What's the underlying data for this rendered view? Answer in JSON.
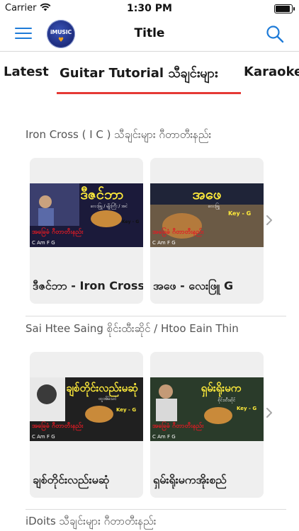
{
  "status_bar": {
    "carrier": "Carrier",
    "time": "1:30 PM",
    "battery_level": 1.0
  },
  "navbar": {
    "title": "Title",
    "logo_text": "iMUSIC"
  },
  "tabs": [
    {
      "label": "Latest"
    },
    {
      "label": "Guitar Tutorial သီချင်းများ"
    },
    {
      "label": "Karaoke"
    }
  ],
  "sections": [
    {
      "title": "Iron Cross ( I C ) သီချင်းများ ဂီတာတီးနည်း",
      "cards": [
        {
          "title": "ဒီဇင်ဘာ - Iron Cross",
          "thumb_headline": "ဒီဇင်ဘာ",
          "thumb_sub": "လေးဖြူ / မျိုးကြီး / အငဲ",
          "thumb_tag": "အခြေခံ ဂီတာတီးနည်း",
          "thumb_key": "Key - G",
          "thumb_chords": "C  Am  F  G"
        },
        {
          "title": "အဖေ - လေးဖြူ G",
          "thumb_headline": "အဖေ",
          "thumb_sub": "လေးဖြူ",
          "thumb_tag": "အခြေခံ ဂီတာတီးနည်း",
          "thumb_key": "Key - G",
          "thumb_chords": "C  Am  F  G"
        }
      ]
    },
    {
      "title": "Sai Htee Saing စိုင်းထီးဆိုင် / Htoo Eain Thin",
      "cards": [
        {
          "title": "ချစ်တိုင်းလည်းမဆုံ",
          "thumb_headline": "ချစ်တိုင်းလည်းမဆုံ",
          "thumb_sub": "ထူးအိမ်သင်",
          "thumb_tag": "အခြေခံ ဂီတာတီးနည်း",
          "thumb_key": "Key - G",
          "thumb_chords": "C  Am  F  G"
        },
        {
          "title": "ရှမ်းရိုးမကအိုးစည်",
          "thumb_headline": "ရှမ်းရိုးမက",
          "thumb_sub": "စိုင်းထီးဆိုင်",
          "thumb_tag": "အခြေခံ ဂီတာတီးနည်း",
          "thumb_key": "Key - G",
          "thumb_chords": "C  Am  F  G"
        }
      ]
    },
    {
      "title": "iDoits သီချင်းများ ဂီတာတီးနည်း",
      "cards": []
    }
  ],
  "colors": {
    "accent": "#1e7bd8",
    "tab_indicator": "#e53935",
    "card_bg": "#efefef",
    "thumb_bg": "#1b1a3a",
    "tag_red": "#e01b24",
    "headline_yellow": "#ffeb3b"
  },
  "icons": {
    "menu": "hamburger-icon",
    "search": "search-icon",
    "chevron": "chevron-right-icon",
    "wifi": "wifi-icon"
  }
}
